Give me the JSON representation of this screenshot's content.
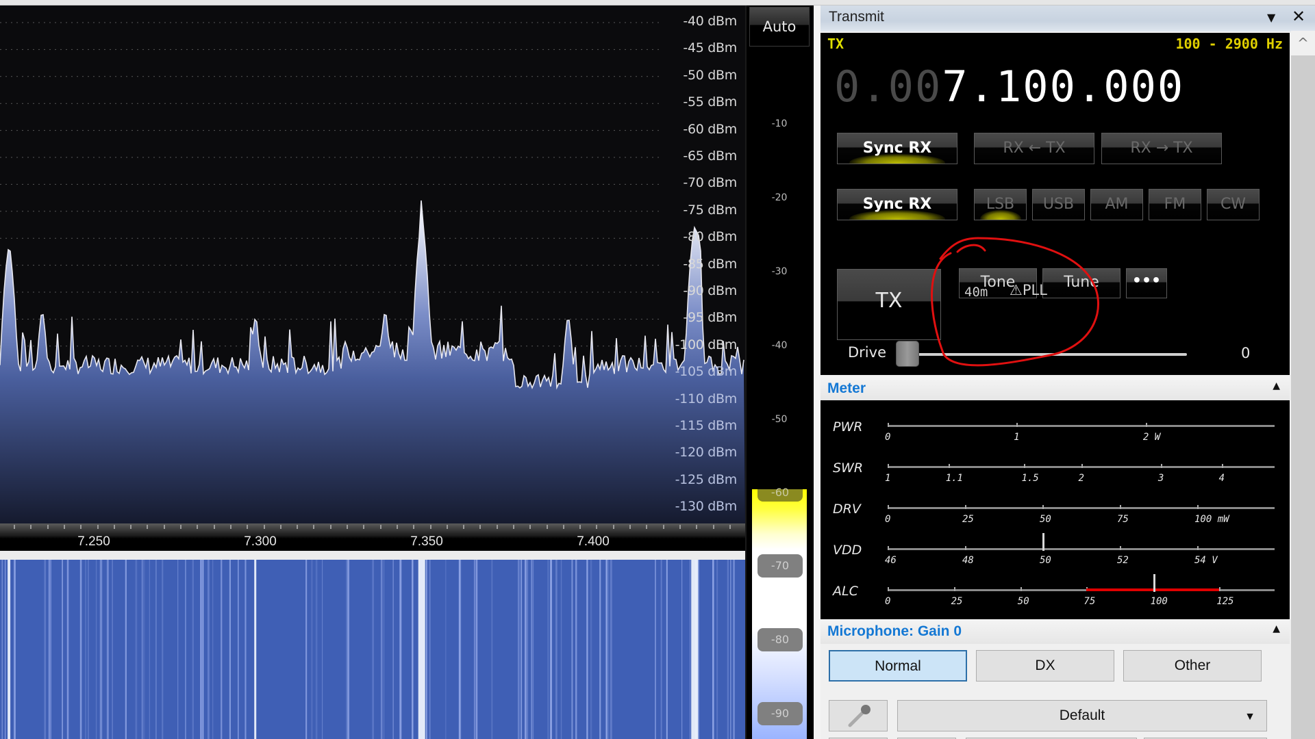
{
  "spectrum": {
    "dbm_labels": [
      "-40 dBm",
      "-45 dBm",
      "-50 dBm",
      "-55 dBm",
      "-60 dBm",
      "-65 dBm",
      "-70 dBm",
      "-75 dBm",
      "-80 dBm",
      "-85 dBm",
      "-90 dBm",
      "-95 dBm",
      "-100 dBm",
      "-105 dBm",
      "-110 dBm",
      "-115 dBm",
      "-120 dBm",
      "-125 dBm",
      "-130 dBm"
    ],
    "freq_labels": [
      "7.250",
      "7.300",
      "7.350",
      "7.400"
    ],
    "fill_color": "#5a6fae",
    "trace_color": "#e8e8f0",
    "peaks_mhz_dbm": [
      {
        "f": 7.2245,
        "dbm": -82
      },
      {
        "f": 7.2345,
        "dbm": -94
      },
      {
        "f": 7.3485,
        "dbm": -77
      },
      {
        "f": 7.3375,
        "dbm": -94
      },
      {
        "f": 7.2985,
        "dbm": -95
      },
      {
        "f": 7.3925,
        "dbm": -95
      },
      {
        "f": 7.4305,
        "dbm": -78
      }
    ]
  },
  "waterfall": {
    "base_color": "#3f5fb5"
  },
  "level_scale": {
    "auto_label": "Auto",
    "ticks": [
      "-10",
      "-20",
      "-30",
      "-40",
      "-50"
    ],
    "pills": [
      "-60",
      "-70",
      "-80",
      "-90"
    ]
  },
  "transmit": {
    "title": "Transmit",
    "tx_label": "TX",
    "bandwidth": "100 - 2900 Hz",
    "frequency_dim": "0.00",
    "frequency_bright": "7.100.000",
    "sync_rx_1": "Sync RX",
    "rx_to_tx": "RX ← TX",
    "rx_from_tx": "RX → TX",
    "sync_rx_2": "Sync RX",
    "modes": [
      "LSB",
      "USB",
      "AM",
      "FM",
      "CW"
    ],
    "active_mode": "LSB",
    "tx_button": "TX",
    "tone": "Tone",
    "tune": "Tune",
    "more": "•••",
    "band": "40m",
    "pll_warning": "⚠PLL",
    "drive_label": "Drive",
    "drive_value": "0",
    "drive_level": 0
  },
  "meter": {
    "title": "Meter",
    "rows": [
      {
        "name": "PWR",
        "labels": [
          [
            "0",
            0
          ],
          [
            "1",
            0.333
          ],
          [
            "2 W",
            0.667
          ]
        ]
      },
      {
        "name": "SWR",
        "labels": [
          [
            "1",
            0
          ],
          [
            "1.1",
            0.157
          ],
          [
            "1.5",
            0.353
          ],
          [
            "2",
            0.5
          ],
          [
            "3",
            0.706
          ],
          [
            "4",
            0.863
          ]
        ]
      },
      {
        "name": "DRV",
        "labels": [
          [
            "0",
            0
          ],
          [
            "25",
            0.2
          ],
          [
            "50",
            0.4
          ],
          [
            "75",
            0.6
          ],
          [
            "100 mW",
            0.8
          ]
        ]
      },
      {
        "name": "VDD",
        "labels": [
          [
            "46",
            0
          ],
          [
            "48",
            0.2
          ],
          [
            "50",
            0.4
          ],
          [
            "52",
            0.6
          ],
          [
            "54 V",
            0.8
          ]
        ],
        "needle": 50
      },
      {
        "name": "ALC",
        "labels": [
          [
            "0",
            0
          ],
          [
            "25",
            0.171
          ],
          [
            "50",
            0.343
          ],
          [
            "75",
            0.514
          ],
          [
            "100",
            0.686
          ],
          [
            "125",
            0.857
          ]
        ],
        "needle": 100,
        "red_range": [
          75,
          125
        ]
      }
    ]
  },
  "microphone": {
    "title": "Microphone: Gain 0",
    "presets": [
      "Normal",
      "DX",
      "Other"
    ],
    "selected_preset": "Normal",
    "source": "Default"
  },
  "colors": {
    "accent_blue": "#1478d4",
    "tx_yellow": "#e0e000",
    "alc_red": "#e00000",
    "annotation_red": "#e01010"
  }
}
